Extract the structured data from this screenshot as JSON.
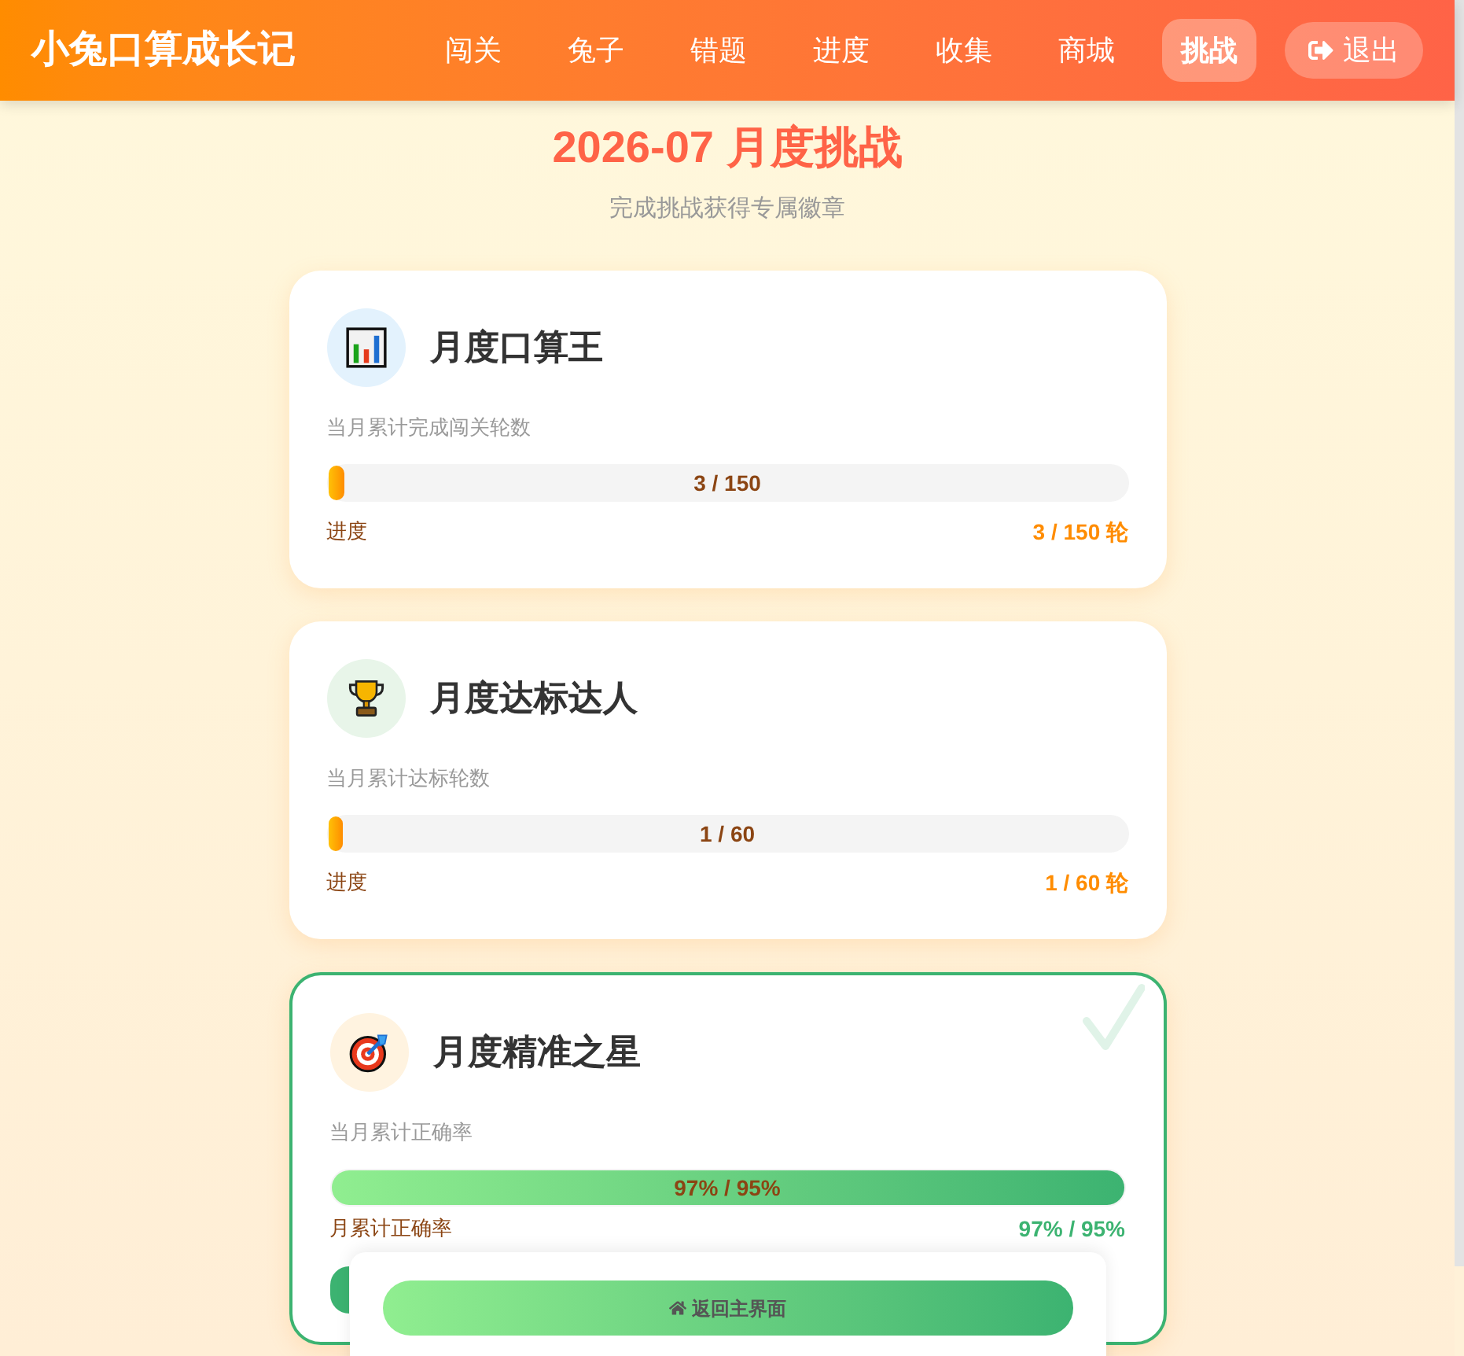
{
  "header": {
    "logo": "小兔口算成长记",
    "nav": [
      {
        "label": "闯关",
        "selected": false
      },
      {
        "label": "兔子",
        "selected": false
      },
      {
        "label": "错题",
        "selected": false
      },
      {
        "label": "进度",
        "selected": false
      },
      {
        "label": "收集",
        "selected": false
      },
      {
        "label": "商城",
        "selected": false
      },
      {
        "label": "挑战",
        "selected": true
      }
    ],
    "logout": {
      "label": "退出"
    }
  },
  "page": {
    "title": "2026-07 月度挑战",
    "subtitle": "完成挑战获得专属徽章"
  },
  "challenges": [
    {
      "title": "月度口算王",
      "description": "当月累计完成闯关轮数",
      "bar_text": "3 / 150",
      "footer_label": "进度",
      "footer_value": "3 / 150 轮",
      "level": 0.02,
      "completed": false
    },
    {
      "title": "月度达标达人",
      "description": "当月累计达标轮数",
      "bar_text": "1 / 60",
      "footer_label": "进度",
      "footer_value": "1 / 60 轮",
      "level": 0.017,
      "completed": false
    },
    {
      "title": "月度精准之星",
      "description": "当月累计正确率",
      "bar_text": "97% / 95%",
      "footer_label": "月累计正确率",
      "footer_value": "97% / 95%",
      "level": 1,
      "completed": true
    }
  ],
  "bottom_bar": {
    "button": "返回主界面"
  }
}
